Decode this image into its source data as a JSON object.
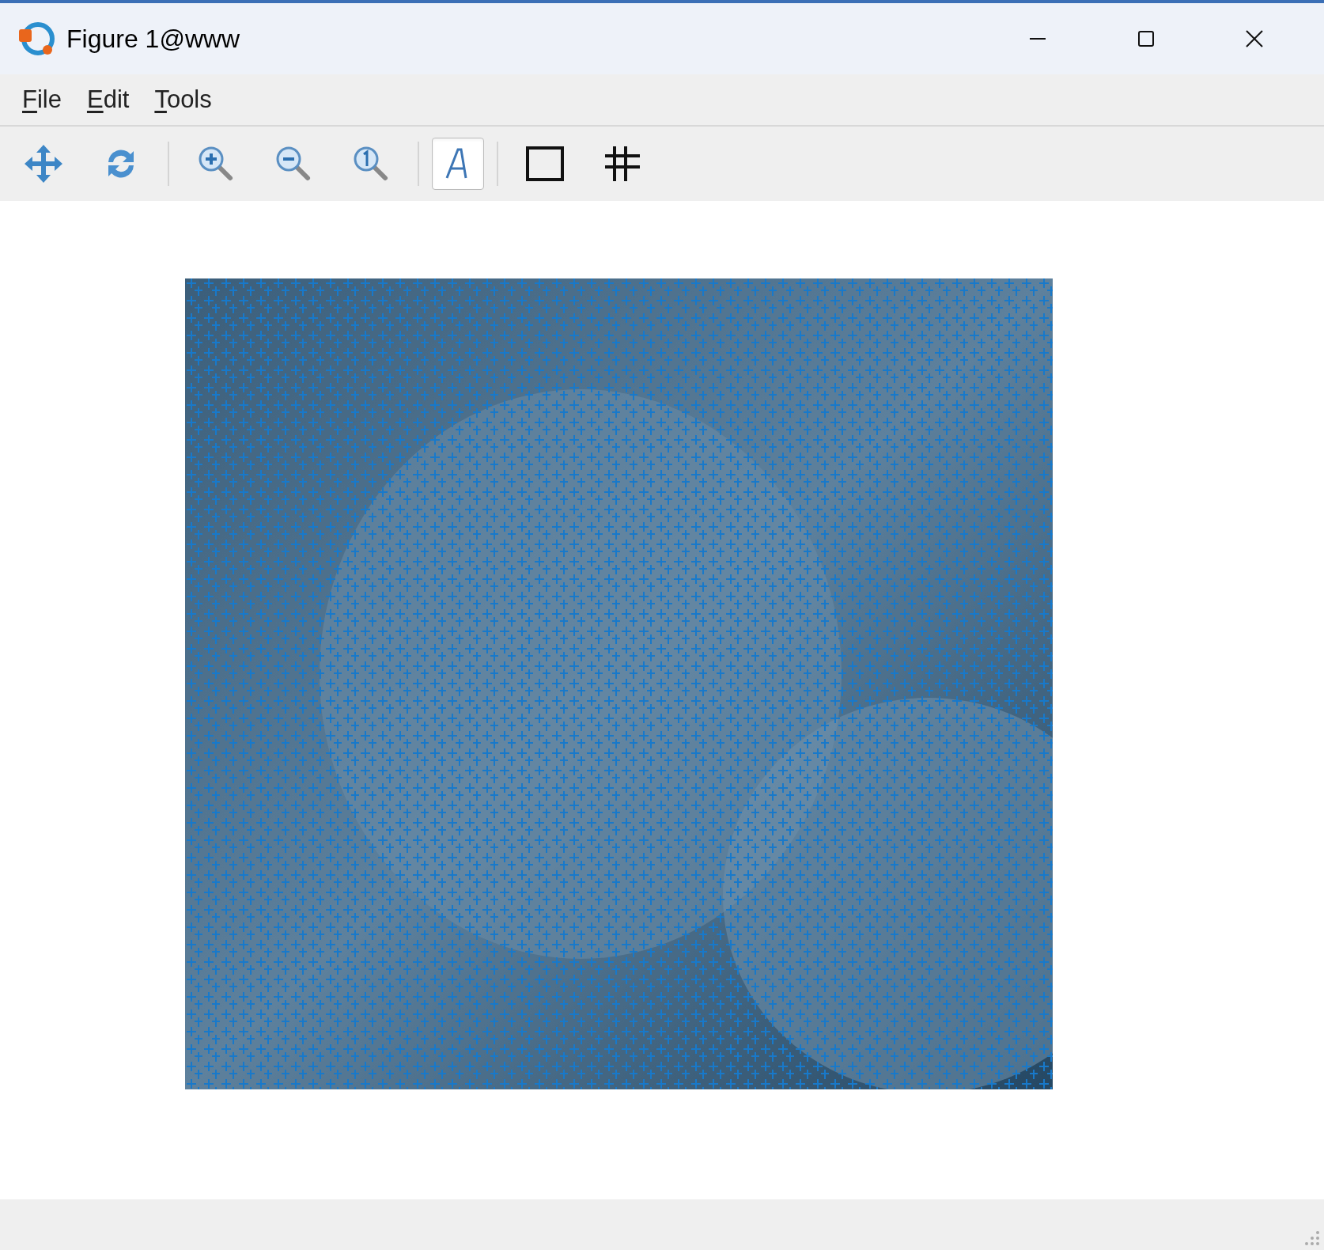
{
  "window": {
    "title": "Figure 1@www"
  },
  "menu": [
    {
      "label": "File",
      "mnemonic_underlined": true
    },
    {
      "label": "Edit",
      "mnemonic_underlined": true
    },
    {
      "label": "Tools",
      "mnemonic_underlined": true
    }
  ],
  "toolbar": [
    {
      "kind": "pan",
      "pressed": false
    },
    {
      "kind": "rotate",
      "pressed": false
    },
    {
      "kind": "separator"
    },
    {
      "kind": "zoom-in",
      "pressed": false
    },
    {
      "kind": "zoom-out",
      "pressed": false
    },
    {
      "kind": "zoom-reset",
      "pressed": false
    },
    {
      "kind": "separator"
    },
    {
      "kind": "text",
      "pressed": true
    },
    {
      "kind": "separator"
    },
    {
      "kind": "box",
      "pressed": false
    },
    {
      "kind": "grid",
      "pressed": false
    }
  ]
}
